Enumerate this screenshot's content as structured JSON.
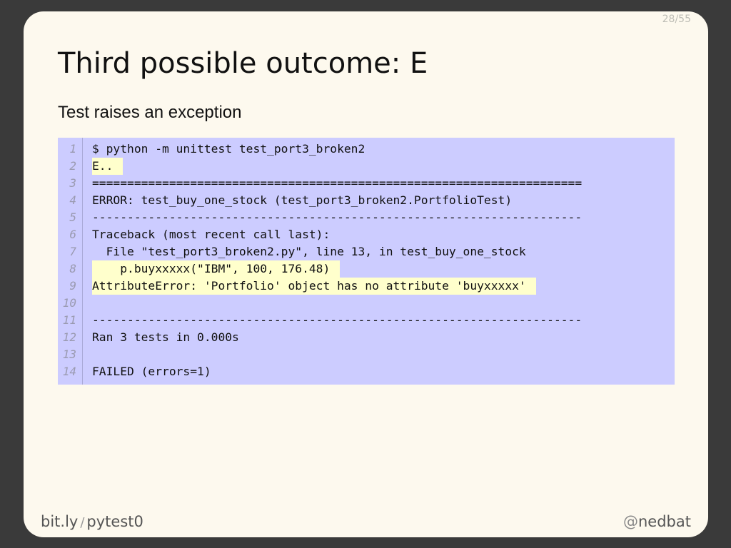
{
  "slide": {
    "counter": "28/55",
    "title": "Third possible outcome: E",
    "subtitle": "Test raises an exception"
  },
  "code": {
    "lines": [
      {
        "n": "1",
        "text": "$ python -m unittest test_port3_broken2",
        "highlight": false
      },
      {
        "n": "2",
        "text": "E..",
        "highlight": true
      },
      {
        "n": "3",
        "text": "======================================================================",
        "highlight": false
      },
      {
        "n": "4",
        "text": "ERROR: test_buy_one_stock (test_port3_broken2.PortfolioTest)",
        "highlight": false
      },
      {
        "n": "5",
        "text": "----------------------------------------------------------------------",
        "highlight": false
      },
      {
        "n": "6",
        "text": "Traceback (most recent call last):",
        "highlight": false
      },
      {
        "n": "7",
        "text": "  File \"test_port3_broken2.py\", line 13, in test_buy_one_stock",
        "highlight": false
      },
      {
        "n": "8",
        "text": "    p.buyxxxxx(\"IBM\", 100, 176.48)",
        "highlight": true
      },
      {
        "n": "9",
        "text": "AttributeError: 'Portfolio' object has no attribute 'buyxxxxx'",
        "highlight": true
      },
      {
        "n": "10",
        "text": "",
        "highlight": false
      },
      {
        "n": "11",
        "text": "----------------------------------------------------------------------",
        "highlight": false
      },
      {
        "n": "12",
        "text": "Ran 3 tests in 0.000s",
        "highlight": false
      },
      {
        "n": "13",
        "text": "",
        "highlight": false
      },
      {
        "n": "14",
        "text": "FAILED (errors=1)",
        "highlight": false
      }
    ]
  },
  "footer": {
    "left_a": "bit.ly",
    "left_sep": "/",
    "left_b": "pytest0",
    "right_at": "@",
    "right_name": "nedbat"
  },
  "colors": {
    "page_bg": "#3a3a3a",
    "slide_bg": "#fdf9ee",
    "code_bg": "#ccccff",
    "highlight_bg": "#ffffcc"
  }
}
